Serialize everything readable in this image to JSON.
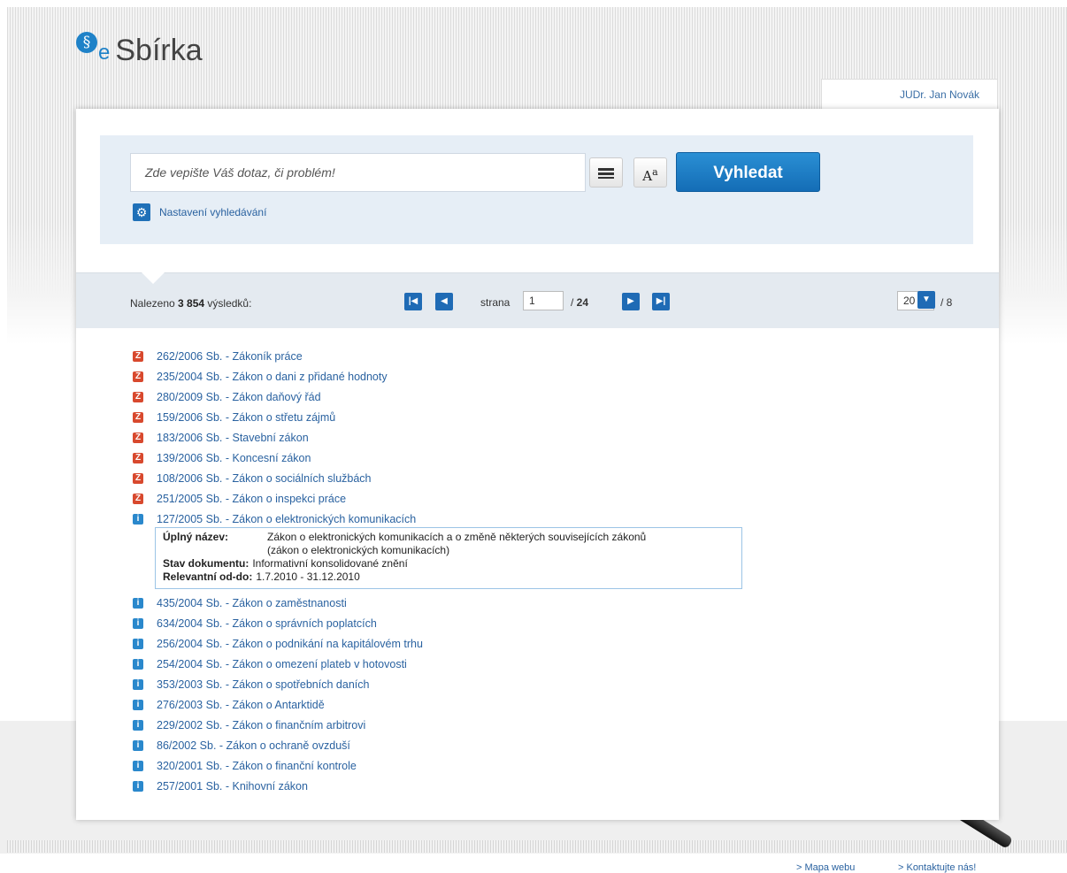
{
  "logo": {
    "mark": "§",
    "e": "e",
    "name": "Sbírka"
  },
  "user": {
    "name": "JUDr. Jan Novák"
  },
  "search": {
    "placeholder": "Zde vepište Váš dotaz, či problém!",
    "button": "Vyhledat",
    "settings_link": "Nastavení vyhledávání"
  },
  "results_bar": {
    "found_label": "Nalezeno",
    "found_count": "3 854",
    "found_suffix": "výsledků:",
    "page_label": "strana",
    "page_value": "1",
    "page_total": "24",
    "per_page": "20",
    "per_page_total": "8"
  },
  "results": [
    {
      "type": "Z",
      "title": "262/2006 Sb. - Zákoník práce"
    },
    {
      "type": "Z",
      "title": "235/2004 Sb. - Zákon o dani z přidané hodnoty"
    },
    {
      "type": "Z",
      "title": "280/2009 Sb. - Zákon daňový řád"
    },
    {
      "type": "Z",
      "title": "159/2006 Sb. - Zákon o střetu zájmů"
    },
    {
      "type": "Z",
      "title": "183/2006 Sb. - Stavební zákon"
    },
    {
      "type": "Z",
      "title": "139/2006 Sb. - Koncesní zákon"
    },
    {
      "type": "Z",
      "title": "108/2006 Sb. - Zákon o sociálních službách"
    },
    {
      "type": "Z",
      "title": "251/2005 Sb. - Zákon o inspekci práce"
    },
    {
      "type": "i",
      "title": "127/2005 Sb. - Zákon o elektronických komunikacích"
    },
    {
      "type": "i",
      "title": "435/2004 Sb. - Zákon o zaměstnanosti"
    },
    {
      "type": "i",
      "title": "634/2004 Sb. - Zákon o správních poplatcích"
    },
    {
      "type": "i",
      "title": "256/2004 Sb. - Zákon o podnikání na kapitálovém trhu"
    },
    {
      "type": "i",
      "title": "254/2004 Sb. - Zákon o omezení plateb v hotovosti"
    },
    {
      "type": "i",
      "title": "353/2003 Sb. - Zákon o spotřebních daních"
    },
    {
      "type": "i",
      "title": "276/2003 Sb. - Zákon o Antarktidě"
    },
    {
      "type": "i",
      "title": "229/2002 Sb. - Zákon o finančním arbitrovi"
    },
    {
      "type": "i",
      "title": "86/2002 Sb. - Zákon o ochraně ovzduší"
    },
    {
      "type": "i",
      "title": "320/2001 Sb. - Zákon o finanční kontrole"
    },
    {
      "type": "i",
      "title": "257/2001 Sb. - Knihovní zákon"
    }
  ],
  "detail": {
    "full_name_label": "Úplný název:",
    "full_name_line1": "Zákon o elektronických komunikacích a o změně některých souvisejících zákonů",
    "full_name_line2": "(zákon o elektronických komunikacích)",
    "status_label": "Stav dokumentu:",
    "status_value": "Informativní konsolidované znění",
    "relevance_label": "Relevantní od-do:",
    "relevance_value": "1.7.2010 - 31.12.2010"
  },
  "footer": {
    "sitemap": "> Mapa webu",
    "contact": "> Kontaktujte nás!"
  },
  "colors": {
    "accent": "#1f6bb5",
    "link": "#2a62a0",
    "badge_z": "#d8492e",
    "badge_i": "#2a88cc"
  }
}
